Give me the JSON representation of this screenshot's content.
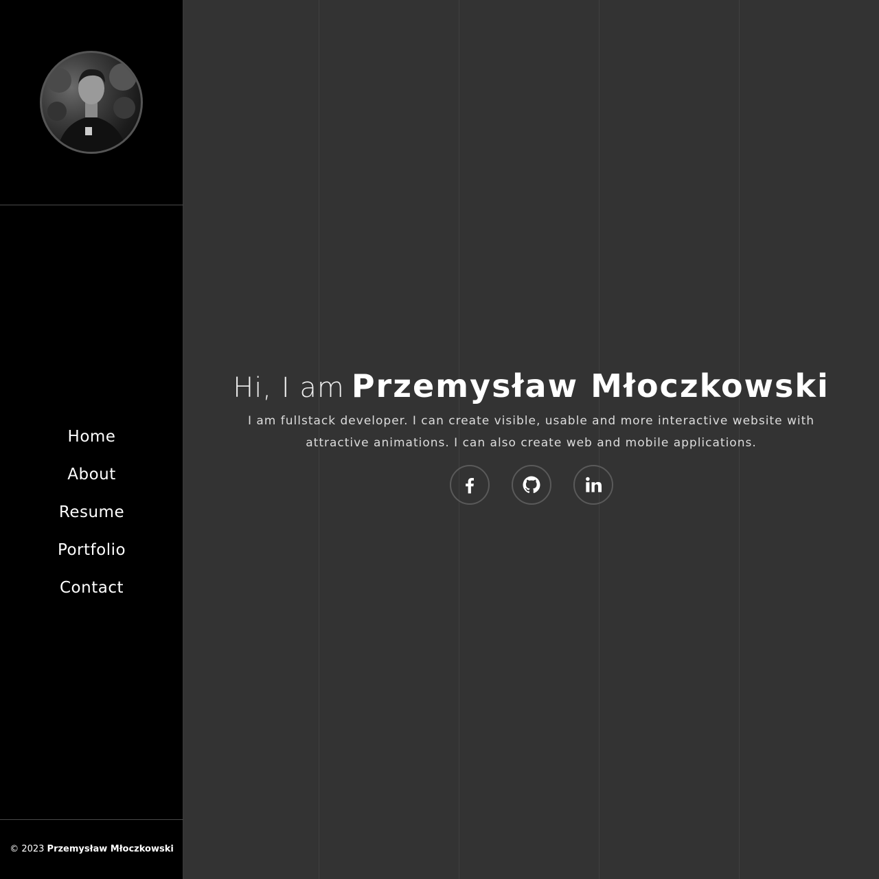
{
  "sidebar": {
    "avatar_alt": "Przemysław Młoczkowski",
    "nav": [
      {
        "label": "Home"
      },
      {
        "label": "About"
      },
      {
        "label": "Resume"
      },
      {
        "label": "Portfolio"
      },
      {
        "label": "Contact"
      }
    ],
    "footer": {
      "copyright": "© 2023",
      "owner": "Przemysław Młoczkowski"
    }
  },
  "hero": {
    "greeting": "Hi, I am",
    "name": "Przemysław Młoczkowski",
    "description": "I am fullstack developer. I can create visible, usable and more interactive website with attractive animations. I can also create web and mobile applications."
  },
  "socials": [
    {
      "icon": "facebook-icon"
    },
    {
      "icon": "github-icon"
    },
    {
      "icon": "linkedin-icon"
    }
  ],
  "colors": {
    "sidebar_bg": "#000000",
    "main_bg": "#333333",
    "text": "#ffffff",
    "border": "#555555"
  }
}
